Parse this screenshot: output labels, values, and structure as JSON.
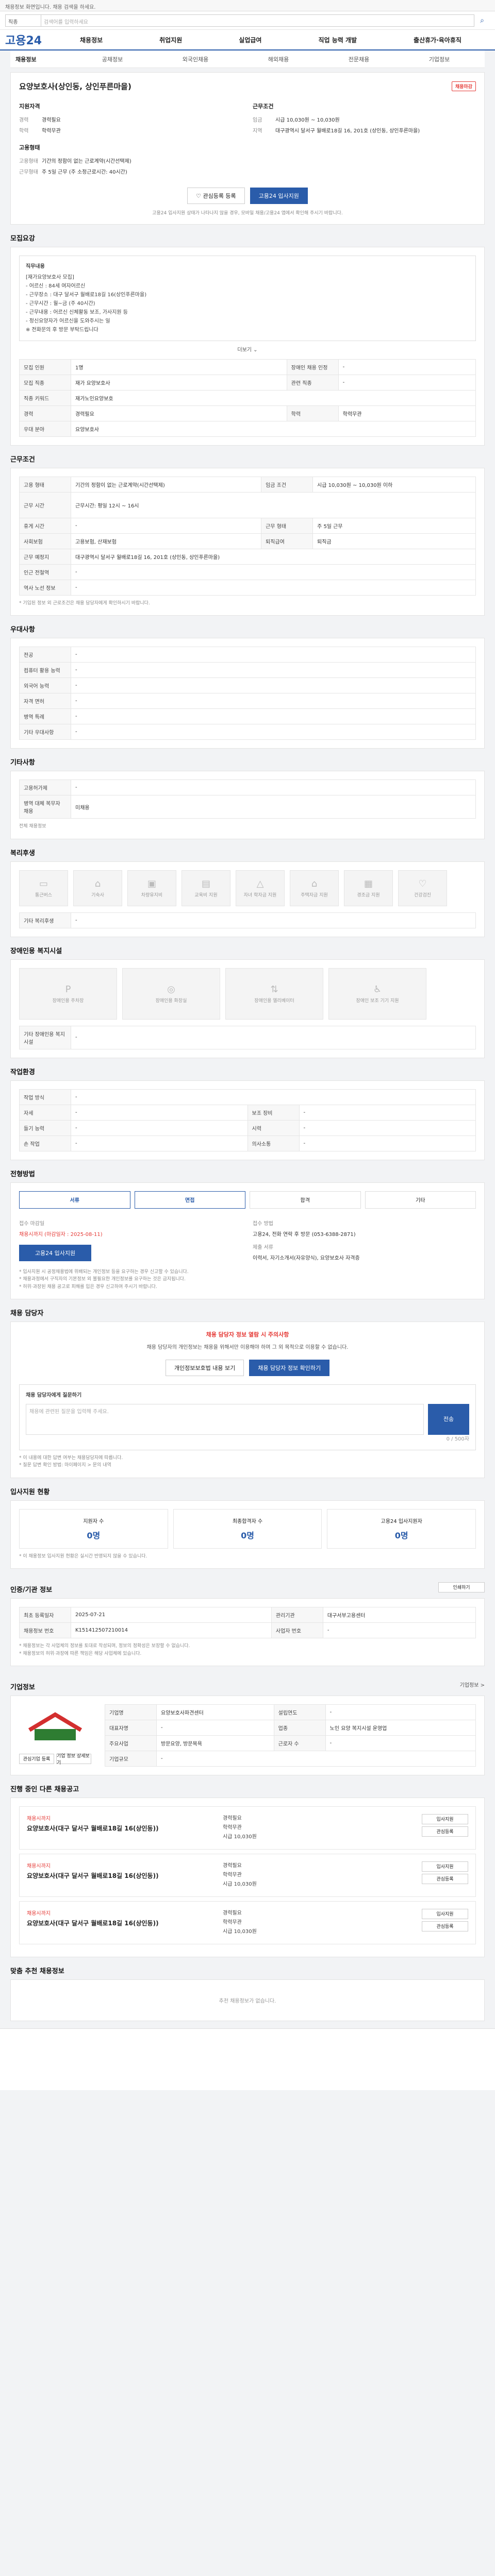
{
  "top_notice": "채용정보 화면입니다. 채용 검색을 하세요.",
  "search": {
    "select": "직종",
    "placeholder": "검색어를 입력하세요"
  },
  "logo": "고용24",
  "gnb": [
    "채용정보",
    "취업지원",
    "실업급여",
    "직업 능력 개발",
    "출산휴가·육아휴직"
  ],
  "subnav": {
    "first": "채용정보",
    "items": [
      "공채정보",
      "외국인채용",
      "해외채용",
      "전문채용",
      "기업정보"
    ]
  },
  "job": {
    "title": "요양보호사(상인동, 상인푸른마을)",
    "badge": "채용마감",
    "qualification_title": "지원자격",
    "work_title": "근무조건",
    "qual": [
      {
        "k": "경력",
        "v": "경력필요"
      },
      {
        "k": "학력",
        "v": "학력무관"
      }
    ],
    "work": [
      {
        "k": "임금",
        "v": "시급 10,030원 ~ 10,030원"
      },
      {
        "k": "지역",
        "v": "대구광역시 달서구 월배로18길 16, 201호 (상인동, 상인푸른마을)"
      }
    ],
    "emp_title": "고용형태",
    "emp": [
      {
        "k": "고용형태",
        "v": "기간의 정함이 없는 근로계약(시간선택제)"
      },
      {
        "k": "근무형태",
        "v": "주 5일 근무 (주 소정근로시간: 40시간)"
      }
    ],
    "scrap_btn": "관심등록 등록",
    "apply_btn": "고용24 입사지원",
    "notice": "고용24 입사지원 상태가 나타나지 않을 경우, 모바일 채용/고용24 앱에서 확인해 주시기 바랍니다."
  },
  "recruit": {
    "section": "모집요강",
    "duty_title": "직무내용",
    "duty_lines": [
      "[재가요양보호사 모집]",
      "- 어르신 : 84세 여자어르신",
      "- 근무장소 : 대구 달서구 월배로18길 16(상인푸른마을)",
      "- 근무시간 : 월~금 (주 40시간)",
      "- 근무내용 : 어르신 신체활동 보조, 가사지원 등",
      "- 정신요양자가 어르신을 도와주시는 일",
      "※ 전화문의 후 방문 부탁드립니다"
    ],
    "more_btn": "더보기 ⌄",
    "rows": [
      {
        "k": "모집 인원",
        "v": "1명",
        "k2": "장애인 채용 인정",
        "v2": "-"
      },
      {
        "k": "모집 직종",
        "v": "재가 요양보호사",
        "k2": "관련 직종",
        "v2": "-"
      },
      {
        "k": "직종 키워드",
        "v": "재가노인요양보호",
        "k2": "",
        "v2": ""
      },
      {
        "k": "경력",
        "v": "경력필요",
        "k2": "학력",
        "v2": "학력무관"
      },
      {
        "k": "우대 분야",
        "v": "요양보호사",
        "k2": "",
        "v2": ""
      }
    ]
  },
  "condition": {
    "section": "근무조건",
    "rows": [
      {
        "k": "고용 형태",
        "v": "기간의 정함이 없는 근로계약(시간선택제)",
        "k2": "임금 조건",
        "v2": "시급 10,030원 ~ 10,030원 이하"
      },
      {
        "k": "근무 시간",
        "v": "근무시간: 평일 12시 ~ 16시",
        "k2": "",
        "v2": ""
      },
      {
        "k": "휴게 시간",
        "v": "-",
        "k2": "근무 형태",
        "v2": "주 5일 근무"
      },
      {
        "k": "사회보험",
        "v": "고용보험, 산재보험",
        "k2": "퇴직급여",
        "v2": "퇴직금"
      },
      {
        "k": "근무 예정지",
        "v": "대구광역시 달서구 월배로18길 16, 201호 (상인동, 상인푸른마을)",
        "k2": "",
        "v2": ""
      },
      {
        "k": "인근 전철역",
        "v": "-",
        "k2": "",
        "v2": ""
      },
      {
        "k": "역사 노선 정보",
        "v": "-",
        "k2": "",
        "v2": ""
      }
    ],
    "note": "* 기입된 정보 외 근로조건은 채용 담당자에게 확인하시기 바랍니다."
  },
  "pref": {
    "section": "우대사항",
    "rows": [
      {
        "k": "전공",
        "v": "-"
      },
      {
        "k": "컴퓨터 활용 능력",
        "v": "-"
      },
      {
        "k": "외국어 능력",
        "v": "-"
      },
      {
        "k": "자격 면허",
        "v": "-"
      },
      {
        "k": "병역 특례",
        "v": "-"
      },
      {
        "k": "기타 우대사항",
        "v": "-"
      }
    ]
  },
  "etc": {
    "section": "기타사항",
    "rows": [
      {
        "k": "고용허가제",
        "v": "-"
      },
      {
        "k": "병역 대체 복무자 채용",
        "v": "미채용"
      }
    ],
    "link": "전체 채용정보"
  },
  "welfare": {
    "section": "복리후생",
    "items": [
      "통근버스",
      "기숙사",
      "차량유지비",
      "교육비 지원",
      "자녀 학자금 지원",
      "주택자금 지원",
      "경조금 지원",
      "건강검진"
    ],
    "note_k": "기타 복리후생",
    "note_v": "-"
  },
  "disabled": {
    "section": "장애인용 복지시설",
    "items": [
      "장애인용 주차장",
      "장애인용 화장실",
      "장애인용 엘리베이터",
      "장애인 보조 기기 지원"
    ],
    "note_k": "기타 장애인용 복지시설",
    "note_v": "-"
  },
  "env": {
    "section": "작업환경",
    "rows": [
      {
        "k": "작업 방식",
        "v": "-",
        "k2": "",
        "v2": ""
      },
      {
        "k": "자세",
        "v": "-",
        "k2": "보조 장비",
        "v2": "-"
      },
      {
        "k": "들기 능력",
        "v": "-",
        "k2": "시력",
        "v2": "-"
      },
      {
        "k": "손 작업",
        "v": "-",
        "k2": "의사소통",
        "v2": "-"
      }
    ]
  },
  "process": {
    "section": "전형방법",
    "steps": [
      "서류",
      "면접",
      "합격",
      "기타"
    ],
    "deadline_k": "접수 마감일",
    "deadline_v": "채용시까지 (마감일자 : 2025-08-11)",
    "method_k": "접수 방법",
    "method_v": "고용24, 전화 연락 후 방문 (053-6388-2871)",
    "docs_k": "제출 서류",
    "docs_v": "이력서, 자기소개서(자유양식), 요양보호사 자격증",
    "apply_btn": "고용24 입사지원",
    "notes": [
      "* 입사지원 시 공정채용법에 위배되는 개인정보 등을 요구하는 경우 신고할 수 있습니다.",
      "* 채용과정에서 구직자의 기본정보 외 불필요한 개인정보를 요구하는 것은 금지됩니다.",
      "* 허위·과장된 채용 공고로 피해를 입은 경우 신고하여 주시기 바랍니다."
    ]
  },
  "contact": {
    "section": "채용 담당자",
    "warn_title": "채용 담당자 정보 열람 시 주의사항",
    "warn_text": "채용 담당자의 개인정보는 채용을 위해서만 이용해야 하며 그 외 목적으로 이용할 수 없습니다.",
    "btn1": "채용 담당자 정보 확인하기",
    "btn2": "개인정보보호법 내용 보기",
    "q_title": "채용 담당자에게 질문하기",
    "q_placeholder": "채용에 관련된 질문을 입력해 주세요.",
    "q_count": "0 / 500자",
    "q_btn": "전송",
    "q_notes": [
      "* 이 내용에 대한 답변 여부는 채용담당자에 따릅니다.",
      "* 질문 답변 확인 방법: 마이페이지 > 문의 내역"
    ]
  },
  "stats": {
    "section": "입사지원 현황",
    "items": [
      {
        "label": "지원자 수",
        "n": "0명"
      },
      {
        "label": "최종합격자 수",
        "n": "0명"
      },
      {
        "label": "고용24 입사지원자",
        "n": "0명"
      }
    ],
    "note": "* 이 채용정보 입사지원 현황은 실시간 반영되지 않을 수 있습니다."
  },
  "info": {
    "section": "인증/기관 정보",
    "print_btn": "인쇄하기",
    "rows": [
      {
        "k": "최초 등록일자",
        "v": "2025-07-21",
        "k2": "관리기관",
        "v2": "대구서부고용센터"
      },
      {
        "k": "채용정보 번호",
        "v": "K151412507210014",
        "k2": "사업자 번호",
        "v2": "-"
      }
    ],
    "notes": [
      "* 채용정보는 각 사업체의 정보를 토대로 작성되며, 정보의 정확성은 보장할 수 없습니다.",
      "* 채용정보의 허위·과장에 따른 책임은 해당 사업체에 있습니다."
    ]
  },
  "company": {
    "section": "기업정보",
    "more": "기업정보 >",
    "rows": [
      {
        "k": "기업명",
        "v": "요양보호사파견센터",
        "k2": "설립연도",
        "v2": "-"
      },
      {
        "k": "대표자명",
        "v": "-",
        "k2": "업종",
        "v2": "노인 요양 복지시설 운영업"
      },
      {
        "k": "주요사업",
        "v": "방문요양, 방문목욕",
        "k2": "근로자 수",
        "v2": "-"
      },
      {
        "k": "기업규모",
        "v": "-",
        "k2": "",
        "v2": ""
      }
    ],
    "btn1": "관심기업 등록",
    "btn2": "기업 정보 상세보기"
  },
  "others": {
    "section": "진행 중인 다른 채용공고",
    "jobs": [
      {
        "co": "채용시까지",
        "title": "요양보호사(대구 달서구 월배로18길 16(상인동))",
        "info": [
          "경력필요",
          "학력무관",
          "시급 10,030원"
        ],
        "btn1": "입사지원",
        "btn2": "관심등록"
      },
      {
        "co": "채용시까지",
        "title": "요양보호사(대구 달서구 월배로18길 16(상인동))",
        "info": [
          "경력필요",
          "학력무관",
          "시급 10,030원"
        ],
        "btn1": "입사지원",
        "btn2": "관심등록"
      },
      {
        "co": "채용시까지",
        "title": "요양보호사(대구 달서구 월배로18길 16(상인동))",
        "info": [
          "경력필요",
          "학력무관",
          "시급 10,030원"
        ],
        "btn1": "입사지원",
        "btn2": "관심등록"
      }
    ]
  },
  "recommend": {
    "section": "맞춤 추천 채용정보",
    "empty": "추천 채용정보가 없습니다."
  }
}
